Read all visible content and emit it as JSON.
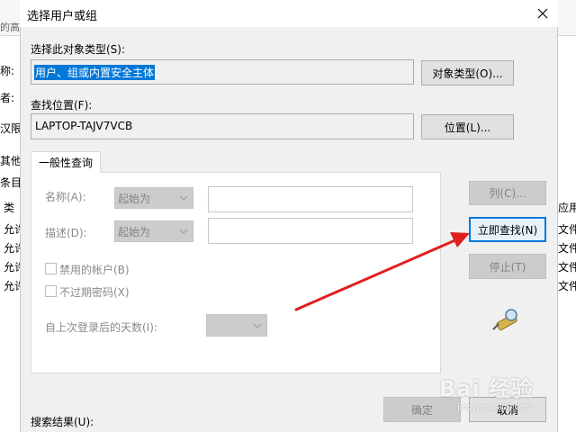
{
  "background": {
    "left_fragments": [
      "的高",
      "称:",
      "者:",
      "汉限",
      "其他",
      "条目",
      "类",
      "允许",
      "允许",
      "允许",
      "允许"
    ],
    "right_fragments": [
      "应用于",
      "文件",
      "文件",
      "文件",
      "文件"
    ]
  },
  "dialog": {
    "title": "选择用户或组",
    "object_type_label": "选择此对象类型(S):",
    "object_type_value": "用户、组或内置安全主体",
    "object_type_button": "对象类型(O)...",
    "location_label": "查找位置(F):",
    "location_value": "LAPTOP-TAJV7VCB",
    "location_button": "位置(L)...",
    "tab_label": "一般性查询",
    "name_label": "名称(A):",
    "name_combo": "起始为",
    "desc_label": "描述(D):",
    "desc_combo": "起始为",
    "disabled_accounts": "禁用的帐户(B)",
    "non_expiring": "不过期密码(X)",
    "days_label": "自上次登录后的天数(I):",
    "columns_button": "列(C)...",
    "find_now_button": "立即查找(N)",
    "stop_button": "停止(T)",
    "results_label": "搜索结果(U):",
    "ok_button": "确定",
    "cancel_button": "取消"
  },
  "icons": {
    "close": "close-icon",
    "search": "search-flashlight-icon",
    "dropdown": "chevron-down-icon"
  },
  "colors": {
    "accent": "#0078d7",
    "arrow": "#e02020"
  },
  "watermark": {
    "main": "Bai 经验",
    "sub": "jingyan.baidu.com"
  }
}
